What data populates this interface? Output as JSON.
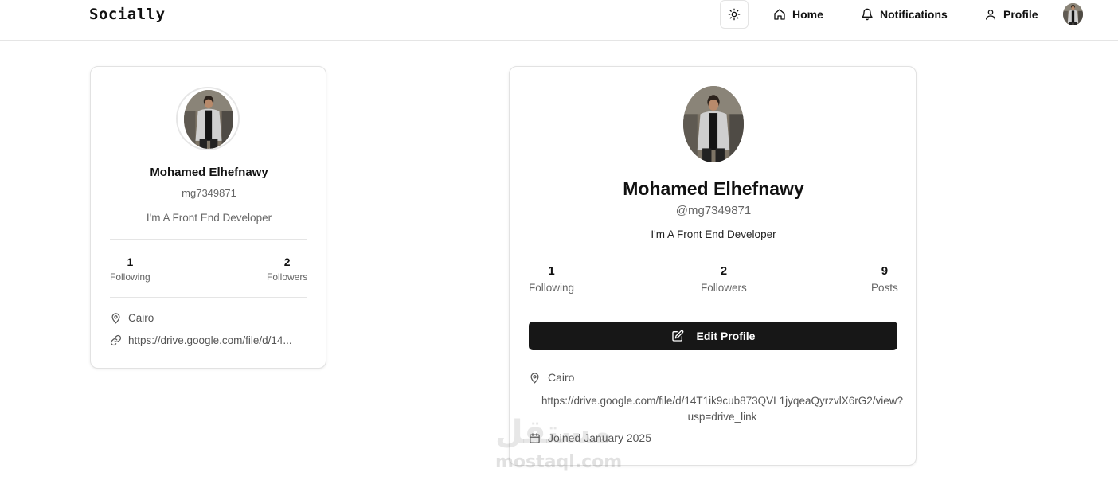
{
  "nav": {
    "brand": "Socially",
    "theme_icon": "sun-icon",
    "links": [
      {
        "label": "Home",
        "icon": "home-icon"
      },
      {
        "label": "Notifications",
        "icon": "bell-icon"
      },
      {
        "label": "Profile",
        "icon": "user-icon"
      }
    ]
  },
  "sidebar_card": {
    "name": "Mohamed Elhefnawy",
    "username": "mg7349871",
    "bio": "I'm A Front End Developer",
    "following_count": "1",
    "following_label": "Following",
    "followers_count": "2",
    "followers_label": "Followers",
    "location": "Cairo",
    "website": "https://drive.google.com/file/d/14..."
  },
  "profile_card": {
    "name": "Mohamed Elhefnawy",
    "username": "@mg7349871",
    "bio": "I'm A Front End Developer",
    "stats": [
      {
        "value": "1",
        "label": "Following"
      },
      {
        "value": "2",
        "label": "Followers"
      },
      {
        "value": "9",
        "label": "Posts"
      }
    ],
    "edit_button": "Edit Profile",
    "location": "Cairo",
    "website_line1": "https://drive.google.com/file/d/14T1ik9cub873QVL1jyqeaQyrzvlX6rG2/view?",
    "website_line2": "usp=drive_link",
    "joined": "Joined January 2025"
  },
  "watermark": {
    "arabic": "مستقل",
    "latin": "mostaql.com"
  },
  "colors": {
    "button_bg": "#171717",
    "border": "#e2e2e2",
    "muted_text": "#666666"
  }
}
